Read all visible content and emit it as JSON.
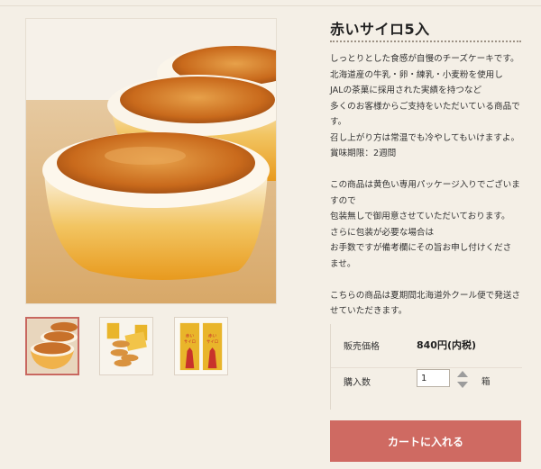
{
  "product": {
    "title": "赤いサイロ5入",
    "description": [
      "しっとりとした食感が自慢のチーズケーキです。",
      "北海道産の牛乳・卵・練乳・小麦粉を使用し",
      "JALの茶菓に採用された実績を持つなど",
      "多くのお客様からご支持をいただいている商品で",
      "す。",
      "召し上がり方は常温でも冷やしてもいけますよ。",
      "賞味期限：2週間",
      "",
      "この商品は黄色い専用パッケージ入りでございま",
      "すので",
      "包装無しで御用意させていただいております。",
      "さらに包装が必要な場合は",
      "お手数ですが備考欄にその旨お申し付けくださ",
      "ませ。",
      "",
      "こちらの商品は夏期間北海道外クール便で発送さ",
      "せていただきます。"
    ]
  },
  "purchase": {
    "price_label": "販売価格",
    "price_value": "840円(内税)",
    "quantity_label": "購入数",
    "quantity_value": "1",
    "unit": "箱",
    "cart_button": "カートに入れる"
  },
  "package_labels": [
    "赤い",
    "サイロ"
  ],
  "colors": {
    "accent": "#cf6a62",
    "background": "#f4efe6",
    "package_yellow": "#e9b52a",
    "package_red": "#c8322b"
  }
}
